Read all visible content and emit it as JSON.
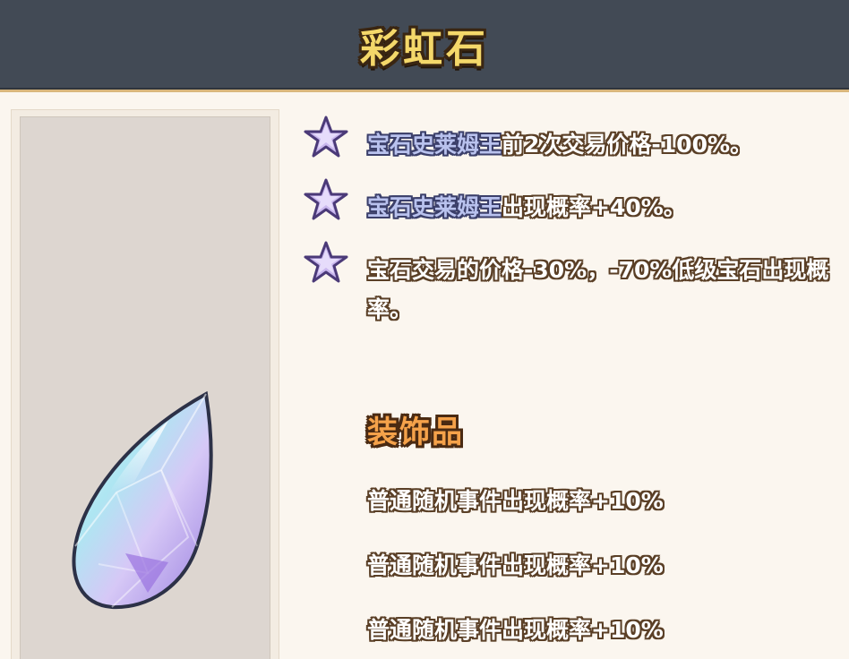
{
  "header": {
    "title": "彩虹石"
  },
  "effects": [
    {
      "icon": "star-icon",
      "highlight": "宝石史莱姆王",
      "text": "前2次交易价格-100%。"
    },
    {
      "icon": "star-icon",
      "highlight": "宝石史莱姆王",
      "text": "出现概率+40%。"
    },
    {
      "icon": "star-icon",
      "highlight": "",
      "text": "宝石交易的价格-30%，-70%低级宝石出现概率。"
    }
  ],
  "decorations": {
    "title": "装饰品",
    "items": [
      "普通随机事件出现概率+10%",
      "普通随机事件出现概率+10%",
      "普通随机事件出现概率+10%"
    ]
  },
  "item": {
    "icon": "rainbow-gem-icon"
  },
  "colors": {
    "header_bg": "#424a55",
    "title_gold": "#f4d86a",
    "section_orange": "#f5a24a",
    "highlight_lavender": "#b9c2ee",
    "star_purple": "#c9b7ee",
    "page_bg": "#fbf6ef"
  }
}
